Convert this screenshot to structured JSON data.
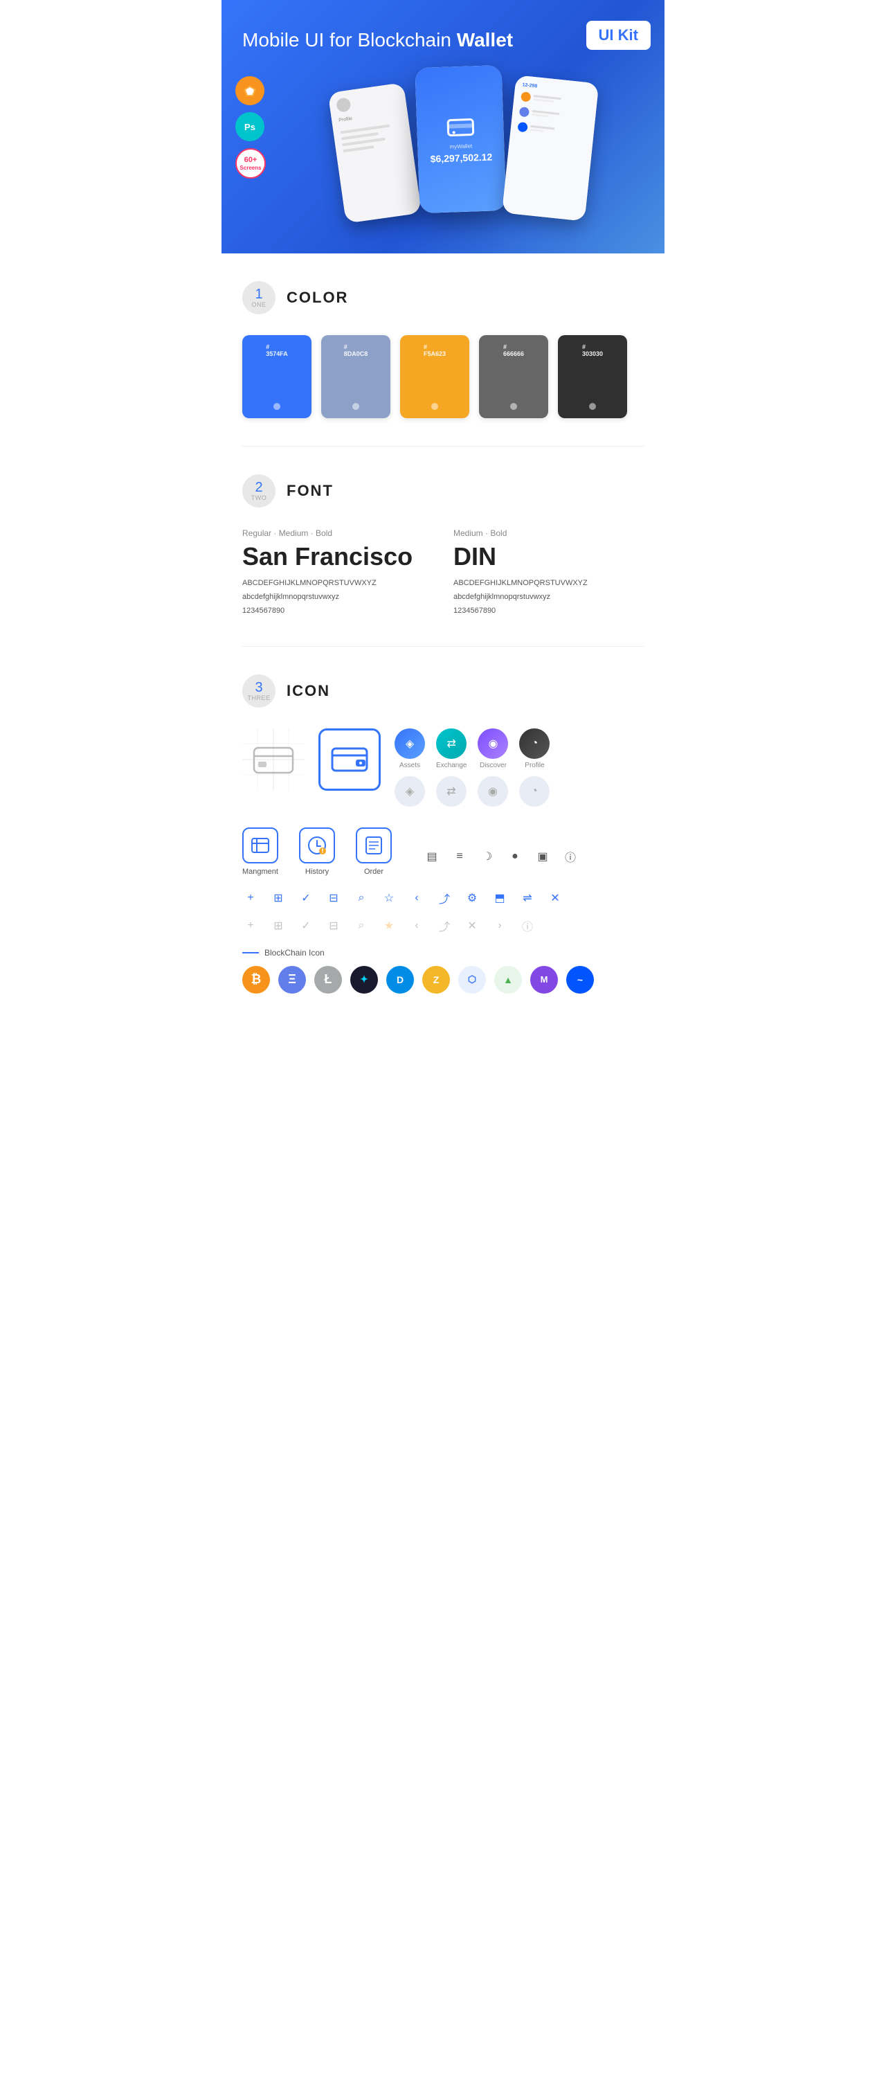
{
  "hero": {
    "title_regular": "Mobile UI for Blockchain ",
    "title_bold": "Wallet",
    "badge": "UI Kit",
    "sketch_label": "Sk",
    "ps_label": "Ps",
    "screens_label": "60+\nScreens"
  },
  "sections": {
    "color": {
      "num": "1",
      "num_text": "ONE",
      "title": "COLOR",
      "swatches": [
        {
          "hex": "#3574FA",
          "label": "3574FA"
        },
        {
          "hex": "#8DA0C8",
          "label": "8DA0C8"
        },
        {
          "hex": "#F5A623",
          "label": "F5A623"
        },
        {
          "hex": "#666666",
          "label": "666666"
        },
        {
          "hex": "#303030",
          "label": "303030"
        }
      ]
    },
    "font": {
      "num": "2",
      "num_text": "TWO",
      "title": "FONT",
      "font1": {
        "meta": "Regular · Medium · Bold",
        "name": "San Francisco",
        "abc_upper": "ABCDEFGHIJKLMNOPQRSTUVWXYZ",
        "abc_lower": "abcdefghijklmnopqrstuvwxyz",
        "numbers": "1234567890"
      },
      "font2": {
        "meta": "Medium · Bold",
        "name": "DIN",
        "abc_upper": "ABCDEFGHIJKLMNOPQRSTUVWXYZ",
        "abc_lower": "abcdefghijklmnopqrstuvwxyz",
        "numbers": "1234567890"
      }
    },
    "icon": {
      "num": "3",
      "num_text": "THREE",
      "title": "ICON",
      "colored_icons": [
        {
          "name": "Assets",
          "type": "blue"
        },
        {
          "name": "Exchange",
          "type": "cyan"
        },
        {
          "name": "Discover",
          "type": "purple"
        },
        {
          "name": "Profile",
          "type": "dark"
        }
      ],
      "mgmt_icons": [
        {
          "name": "Mangment",
          "symbol": "⊡"
        },
        {
          "name": "History",
          "symbol": "⏱"
        },
        {
          "name": "Order",
          "symbol": "📋"
        }
      ],
      "blockchain_label": "BlockChain Icon",
      "crypto_coins": [
        {
          "name": "BTC",
          "class": "crypto-btc",
          "symbol": "₿"
        },
        {
          "name": "ETH",
          "class": "crypto-eth",
          "symbol": "Ξ"
        },
        {
          "name": "LTC",
          "class": "crypto-ltc",
          "symbol": "Ł"
        },
        {
          "name": "WING",
          "class": "crypto-wing",
          "symbol": "✦"
        },
        {
          "name": "DASH",
          "class": "crypto-dash",
          "symbol": "D"
        },
        {
          "name": "ZEC",
          "class": "crypto-zcash",
          "symbol": "Z"
        },
        {
          "name": "GRID",
          "class": "crypto-grid",
          "symbol": "⬡"
        },
        {
          "name": "SAFE",
          "class": "crypto-safe",
          "symbol": "▲"
        },
        {
          "name": "MATIC",
          "class": "crypto-matic",
          "symbol": "M"
        },
        {
          "name": "WAVES",
          "class": "crypto-waves",
          "symbol": "~"
        }
      ]
    }
  }
}
